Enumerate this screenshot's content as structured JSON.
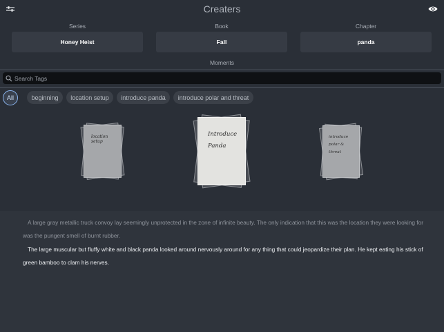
{
  "app": {
    "title": "Creaters"
  },
  "selectors": [
    {
      "label": "Series",
      "value": "Honey Heist"
    },
    {
      "label": "Book",
      "value": "Fall"
    },
    {
      "label": "Chapter",
      "value": "panda"
    }
  ],
  "moments": {
    "label": "Moments",
    "search_placeholder": "Search Tags",
    "tags": [
      "All",
      "beginning",
      "location setup",
      "introduce panda",
      "introduce polar and threat"
    ],
    "active_tag": "All"
  },
  "cards": [
    {
      "text": "location\nsetup"
    },
    {
      "text": "Introduce\nPanda"
    },
    {
      "text": "introduce\npolar &\nthreat"
    }
  ],
  "story": {
    "paragraphs": [
      "A large gray metallic truck convoy lay seemingly unprotected in the zone of infinite beauty. The only indication that this was the location they were looking for was the pungent smell of burnt rubber.",
      "The large muscular but fluffy white and black panda looked around nervously around for any thing that could jeopardize their plan. He kept eating his stick of green bamboo to clam his nerves."
    ]
  },
  "colors": {
    "background": "#2a2f37",
    "panel": "#363b44",
    "accent": "#8ab4ee",
    "text_primary": "#ffffff",
    "text_muted": "#a7acb4"
  },
  "icons": {
    "settings": "sliders-icon",
    "preview": "eye-icon",
    "search": "magnifier-icon"
  }
}
